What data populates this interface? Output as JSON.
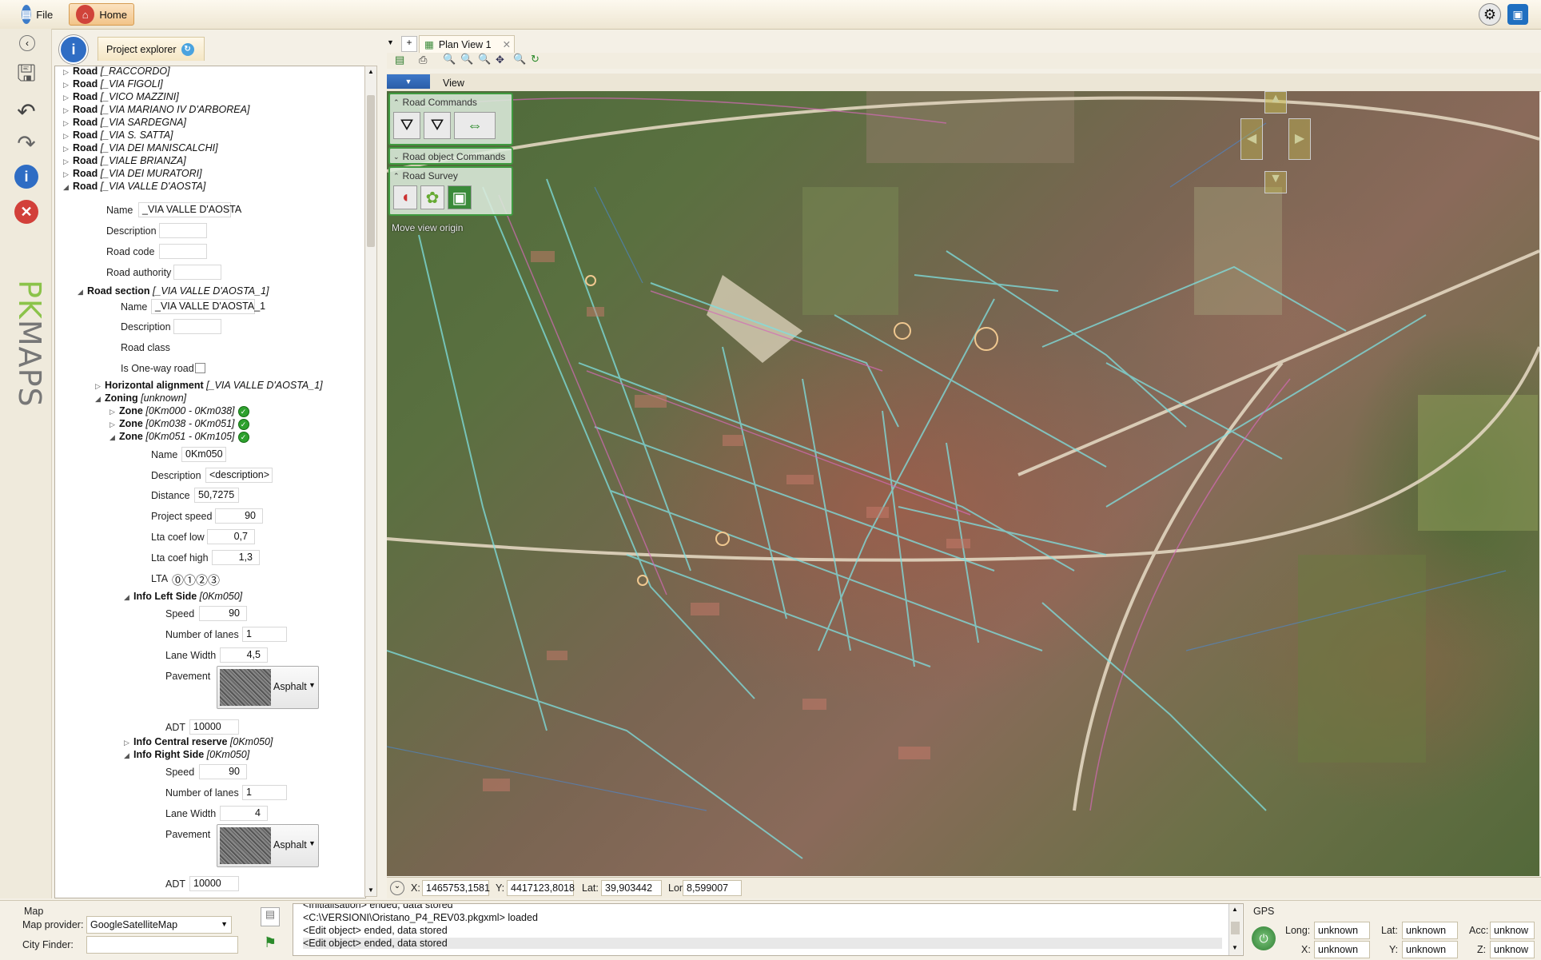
{
  "app": {
    "file_label": "File",
    "home_label": "Home",
    "logo_text": "PKMAPS"
  },
  "explorer": {
    "tab_label": "Project explorer",
    "roads": [
      "_RACCORDO]",
      "_VIA FIGOLI]",
      "_VICO MAZZINI]",
      "_VIA MARIANO IV D'ARBOREA]",
      "_VIA SARDEGNA]",
      "_VIA S. SATTA]",
      "_VIA DEI MANISCALCHI]",
      "_VIALE BRIANZA]",
      "_VIA DEI MURATORI]",
      "_VIA VALLE D'AOSTA]"
    ],
    "road_word": "Road",
    "road_prefix": "[",
    "road_props": {
      "name_label": "Name",
      "name_value": "_VIA VALLE D'AOSTA",
      "description_label": "Description",
      "road_code_label": "Road code",
      "road_authority_label": "Road authority"
    },
    "road_section": {
      "label": "Road section",
      "value": "[_VIA VALLE D'AOSTA_1]",
      "name_label": "Name",
      "name_value": "_VIA VALLE D'AOSTA_1",
      "description_label": "Description",
      "road_class_label": "Road class",
      "oneway_label": "Is One-way road"
    },
    "horizontal": {
      "label": "Horizontal alignment",
      "value": "[_VIA VALLE D'AOSTA_1]"
    },
    "zoning": {
      "label": "Zoning",
      "value": "[unknown]"
    },
    "zones": [
      {
        "label": "Zone",
        "value": "[0Km000 - 0Km038]"
      },
      {
        "label": "Zone",
        "value": "[0Km038 - 0Km051]"
      },
      {
        "label": "Zone",
        "value": "[0Km051 - 0Km105]"
      }
    ],
    "zone_props": {
      "name_label": "Name",
      "name_value": "0Km050",
      "description_label": "Description",
      "description_value": "<description>",
      "distance_label": "Distance",
      "distance_value": "50,7275",
      "project_speed_label": "Project speed",
      "project_speed_value": "90",
      "lta_low_label": "Lta coef low",
      "lta_low_value": "0,7",
      "lta_high_label": "Lta coef high",
      "lta_high_value": "1,3",
      "lta_label": "LTA",
      "lta_value": "⓪①②③"
    },
    "info_left": {
      "label": "Info Left Side",
      "value": "[0Km050]",
      "speed_label": "Speed",
      "speed_value": "90",
      "lanes_label": "Number of lanes",
      "lanes_value": "1",
      "lane_width_label": "Lane Width",
      "lane_width_value": "4,5",
      "pavement_label": "Pavement",
      "pavement_value": "Asphalt",
      "adt_label": "ADT",
      "adt_value": "10000"
    },
    "info_central": {
      "label": "Info Central reserve",
      "value": "[0Km050]"
    },
    "info_right": {
      "label": "Info Right Side",
      "value": "[0Km050]",
      "speed_label": "Speed",
      "speed_value": "90",
      "lanes_label": "Number of lanes",
      "lanes_value": "1",
      "lane_width_label": "Lane Width",
      "lane_width_value": "4",
      "pavement_label": "Pavement",
      "pavement_value": "Asphalt",
      "adt_label": "ADT",
      "adt_value": "10000"
    }
  },
  "plan": {
    "tab_label": "Plan View 1",
    "view_label": "View",
    "panels": {
      "road_commands": "Road Commands",
      "road_object_commands": "Road object Commands",
      "road_survey": "Road Survey"
    },
    "move_view_origin": "Move view origin"
  },
  "coords": {
    "x_label": "X:",
    "x_value": "1465753,1581",
    "y_label": "Y:",
    "y_value": "4417123,8018",
    "lat_label": "Lat:",
    "lat_value": "39,903442",
    "lon_label": "Lon:",
    "lon_value": "8,599007"
  },
  "map_panel": {
    "title": "Map",
    "provider_label": "Map provider:",
    "provider_value": "GoogleSatelliteMap",
    "city_finder_label": "City Finder:"
  },
  "log": {
    "lines": [
      "<Initialisation> ended, data stored",
      "<C:\\VERSIONI\\Oristano_P4_REV03.pkgxml> loaded",
      "<Edit object> ended, data stored",
      "<Edit object> ended, data stored"
    ]
  },
  "gps": {
    "title": "GPS",
    "long_label": "Long:",
    "long_value": "unknown",
    "lat_label": "Lat:",
    "lat_value": "unknown",
    "acc_label": "Acc:",
    "acc_value": "unknow",
    "x_label": "X:",
    "x_value": "unknown",
    "y_label": "Y:",
    "y_value": "unknown",
    "z_label": "Z:",
    "z_value": "unknow"
  }
}
